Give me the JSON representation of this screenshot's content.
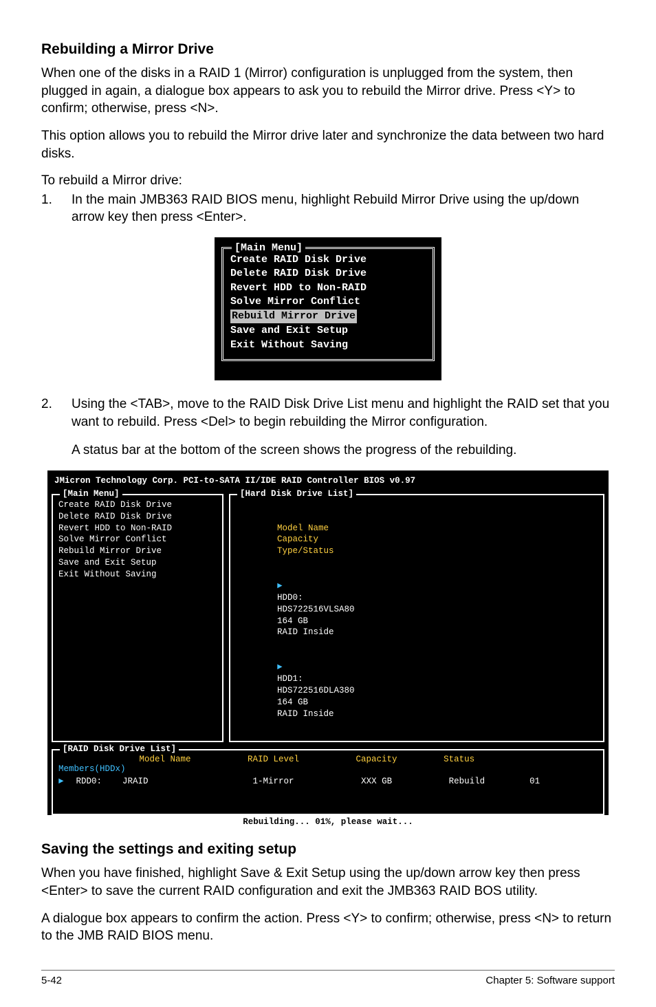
{
  "heading_rebuild": "Rebuilding a Mirror Drive",
  "p1": "When one of the disks in a RAID 1 (Mirror) configuration is unplugged from the system, then plugged in again, a dialogue box appears to ask you to rebuild the Mirror drive. Press <Y> to confirm; otherwise, press <N>.",
  "p2": "This option allows you to rebuild the Mirror drive later and synchronize the data between two hard disks.",
  "p3": "To rebuild a Mirror drive:",
  "step1_num": "1.",
  "step1": "In the main JMB363 RAID BIOS menu, highlight Rebuild Mirror Drive using the up/down arrow key then press <Enter>.",
  "menu": {
    "legend": "[Main Menu]",
    "items": [
      "Create RAID Disk Drive",
      "Delete RAID Disk Drive",
      "Revert HDD to Non-RAID",
      "Solve Mirror Conflict",
      "Rebuild Mirror Drive",
      "Save and Exit Setup",
      "Exit Without Saving"
    ],
    "highlight_index": 4
  },
  "step2_num": "2.",
  "step2": "Using the <TAB>, move to the RAID Disk Drive List menu and highlight the RAID set that you want to rebuild. Press <Del> to begin rebuilding the Mirror configuration.",
  "step2b": "A status bar at the bottom of the screen shows the progress of the rebuilding.",
  "bios": {
    "title": "JMicron Technology Corp. PCI-to-SATA II/IDE RAID Controller BIOS v0.97",
    "main_legend": "[Main Menu]",
    "main_items": [
      "Create RAID Disk Drive",
      "Delete RAID Disk Drive",
      "Revert HDD to Non-RAID",
      "Solve Mirror Conflict",
      "Rebuild Mirror Drive",
      "Save and Exit Setup",
      "Exit Without Saving"
    ],
    "hdd_legend": "[Hard Disk Drive List]",
    "hdd_headers": {
      "model": "Model Name",
      "capacity": "Capacity",
      "type": "Type/Status"
    },
    "hdd_rows": [
      {
        "marker": "►",
        "dev": "HDD0:",
        "model": "HDS722516VLSA80",
        "cap": "164 GB",
        "type": "RAID Inside"
      },
      {
        "marker": "►",
        "dev": "HDD1:",
        "model": "HDS722516DLA380",
        "cap": "164 GB",
        "type": "RAID Inside"
      }
    ],
    "raid_legend": "[RAID Disk Drive List]",
    "raid_headers": {
      "model": "Model Name",
      "level": "RAID Level",
      "capacity": "Capacity",
      "status": "Status"
    },
    "raid_members": "Members(HDDx)",
    "raid_row": {
      "marker": "►",
      "dev": "RDD0:",
      "name": "JRAID",
      "level": "1-Mirror",
      "cap": "XXX GB",
      "status": "Rebuild",
      "members": "01"
    },
    "status_bar": "Rebuilding... 01%, please wait..."
  },
  "heading_save": "Saving the settings and exiting setup",
  "p_save1": "When you have finished, highlight Save & Exit Setup using the up/down arrow key then press <Enter> to save the current RAID configuration and exit the JMB363 RAID BOS utility.",
  "p_save2": "A dialogue box appears to confirm the action. Press <Y> to confirm; otherwise, press <N> to return to the JMB RAID BIOS menu.",
  "footer": {
    "left": "5-42",
    "right": "Chapter 5: Software support"
  }
}
